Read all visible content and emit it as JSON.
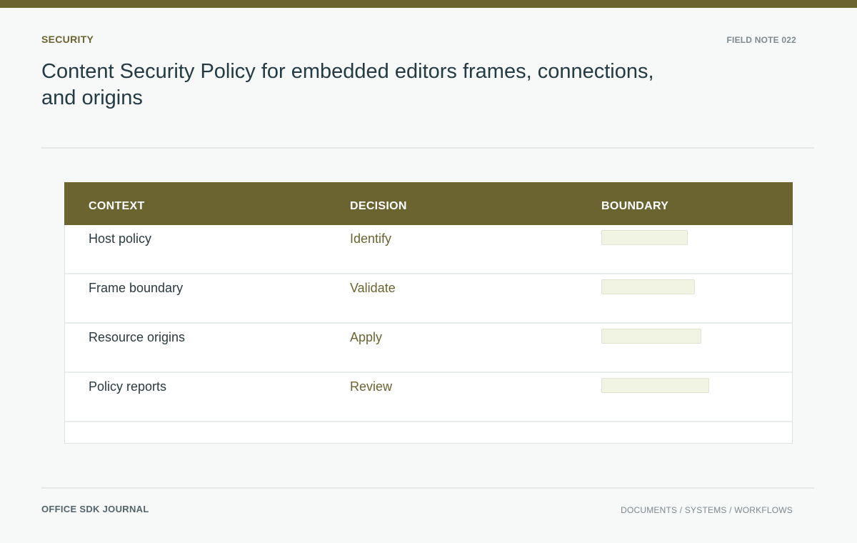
{
  "header": {
    "category": "SECURITY",
    "field_note": "FIELD NOTE 022",
    "title": "Content Security Policy for embedded editors frames, connections, and origins"
  },
  "table": {
    "columns": [
      "CONTEXT",
      "DECISION",
      "BOUNDARY"
    ],
    "rows": [
      {
        "context": "Host policy",
        "decision": "Identify",
        "boundary_level": 0.8
      },
      {
        "context": "Frame boundary",
        "decision": "Validate",
        "boundary_level": 0.87
      },
      {
        "context": "Resource origins",
        "decision": "Apply",
        "boundary_level": 0.93
      },
      {
        "context": "Policy reports",
        "decision": "Review",
        "boundary_level": 1.0
      }
    ]
  },
  "footer": {
    "journal": "OFFICE SDK JOURNAL",
    "sections": "DOCUMENTS / SYSTEMS / WORKFLOWS"
  },
  "colors": {
    "accent": "#6b6431",
    "background": "#f7f9f8",
    "bar_fill": "#f1f3e3"
  }
}
